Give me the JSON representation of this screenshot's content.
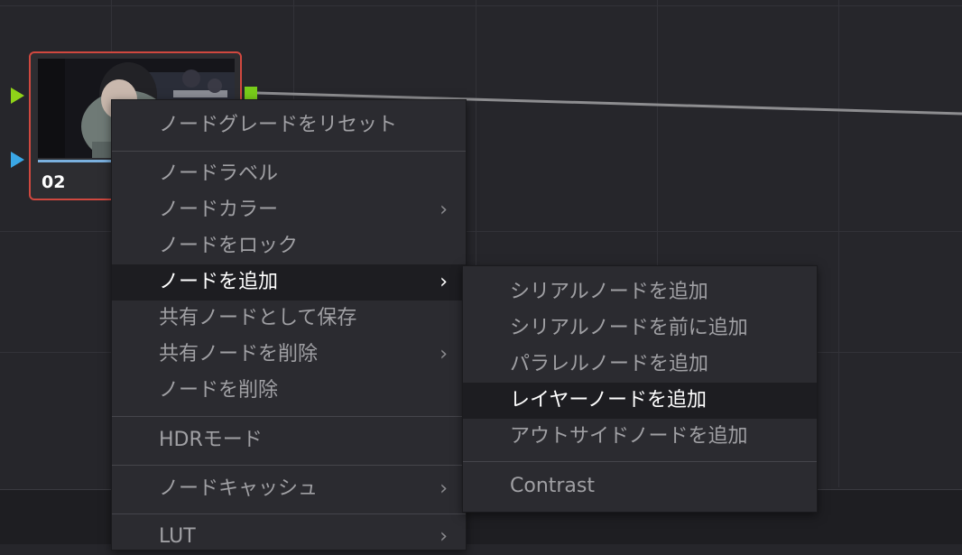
{
  "node": {
    "label": "02"
  },
  "context_menu": {
    "items": [
      {
        "label": "ノードグレードをリセット"
      },
      {
        "label": "ノードラベル"
      },
      {
        "label": "ノードカラー",
        "submenu": true
      },
      {
        "label": "ノードをロック"
      },
      {
        "label": "ノードを追加",
        "submenu": true,
        "highlighted": true
      },
      {
        "label": "共有ノードとして保存"
      },
      {
        "label": "共有ノードを削除",
        "submenu": true
      },
      {
        "label": "ノードを削除"
      },
      {
        "label": "HDRモード"
      },
      {
        "label": "ノードキャッシュ",
        "submenu": true
      },
      {
        "label": "LUT",
        "submenu": true
      }
    ],
    "chevron": "›"
  },
  "submenu": {
    "items": [
      {
        "label": "シリアルノードを追加"
      },
      {
        "label": "シリアルノードを前に追加"
      },
      {
        "label": "パラレルノードを追加"
      },
      {
        "label": "レイヤーノードを追加",
        "highlighted": true
      },
      {
        "label": "アウトサイドノードを追加"
      },
      {
        "label": "Contrast"
      }
    ]
  },
  "colors": {
    "node_border": "#d0483f",
    "input_port_green": "#8fd219",
    "input_port_blue": "#3aa7e6",
    "output_port": "#78cc1a"
  }
}
